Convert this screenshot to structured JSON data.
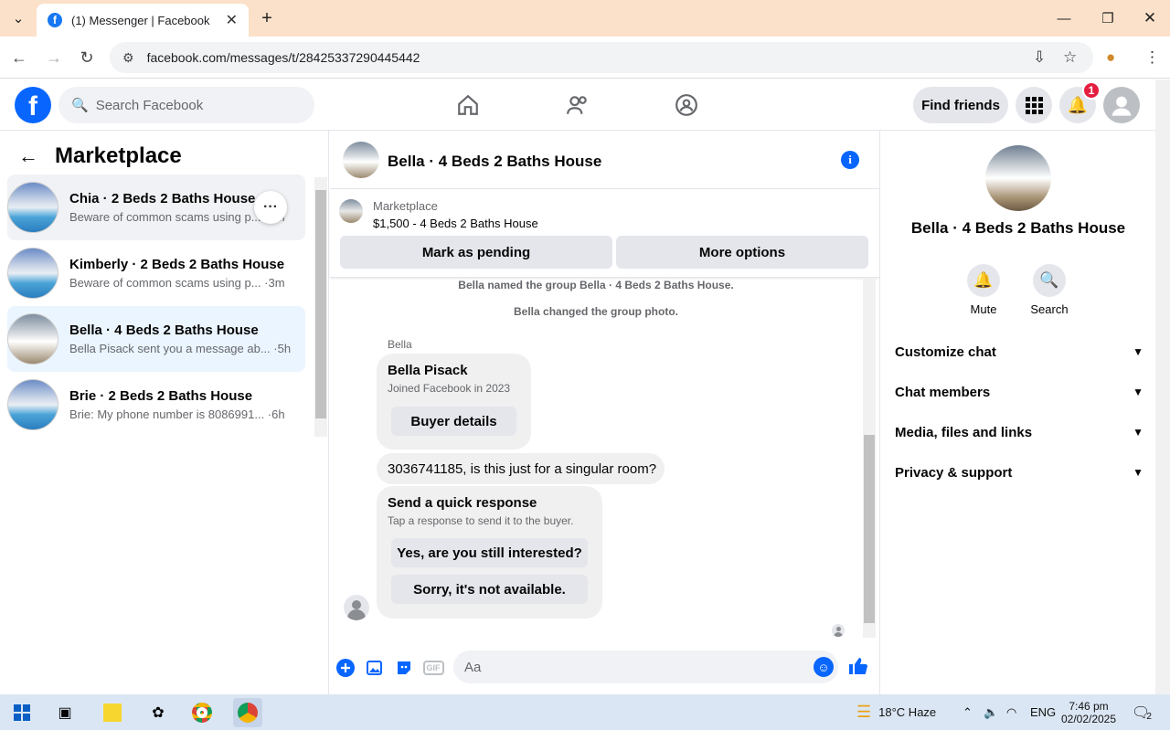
{
  "browser": {
    "tab_title": "(1) Messenger | Facebook",
    "new_tab": "+",
    "url": "facebook.com/messages/t/28425337290445442",
    "window_controls": [
      "minimize",
      "restore",
      "close"
    ]
  },
  "fb": {
    "logo": "f",
    "search_placeholder": "Search Facebook",
    "find_friends": "Find friends",
    "notif_count": "1"
  },
  "sidebar": {
    "title": "Marketplace",
    "conversations": [
      {
        "name": "Chia · 2 Beds 2 Baths House",
        "preview": "Beware of common scams using p... ·4m"
      },
      {
        "name": "Kimberly · 2 Beds 2 Baths House",
        "preview": "Beware of common scams using p... ·3m"
      },
      {
        "name": "Bella · 4 Beds 2 Baths House",
        "preview": "Bella Pisack sent you a message ab... ·5h"
      },
      {
        "name": "Brie · 2 Beds 2 Baths House",
        "preview": "Brie: My phone number is 8086991... ·6h"
      }
    ],
    "more": "···"
  },
  "chat": {
    "title": "Bella · 4 Beds 2 Baths House",
    "listing_source": "Marketplace",
    "listing_price": "$1,500 - 4 Beds 2 Baths House",
    "mark_pending": "Mark as pending",
    "more_options": "More options",
    "sys1": "Bella named the group Bella · 4 Beds 2 Baths House.",
    "sys2": "Bella changed the group photo.",
    "sender": "Bella",
    "card_name": "Bella Pisack",
    "card_sub": "Joined Facebook in 2023",
    "buyer_details": "Buyer details",
    "message": "3036741185, is this just for a singular room?",
    "quick_title": "Send a quick response",
    "quick_sub": "Tap a response to send it to the buyer.",
    "quick1": "Yes, are you still interested?",
    "quick2": "Sorry, it's not available.",
    "composer_placeholder": "Aa",
    "gif": "GIF"
  },
  "details": {
    "name": "Bella · 4 Beds 2 Baths House",
    "mute": "Mute",
    "search": "Search",
    "sections": [
      "Customize chat",
      "Chat members",
      "Media, files and links",
      "Privacy & support"
    ]
  },
  "taskbar": {
    "weather": "18°C  Haze",
    "lang": "ENG",
    "time": "7:46 pm",
    "date": "02/02/2025",
    "notif": "2"
  }
}
